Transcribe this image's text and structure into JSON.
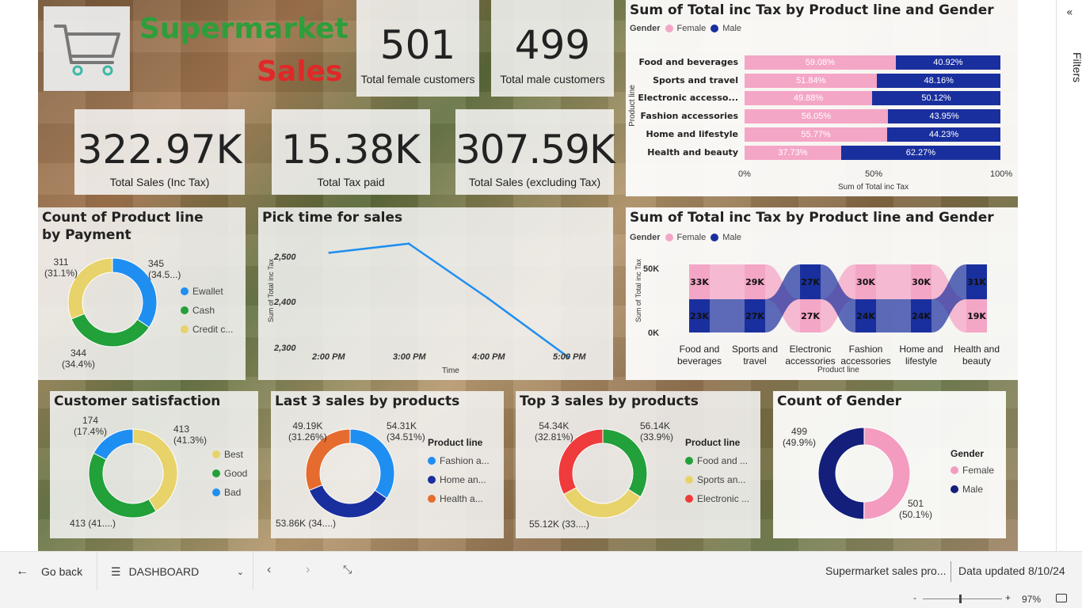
{
  "header": {
    "title_line1": "Supermarket",
    "title_line2": "Sales",
    "cart_icon": "shopping-cart-icon"
  },
  "kpis": {
    "female": {
      "value": "501",
      "label": "Total female customers"
    },
    "male": {
      "value": "499",
      "label": "Total male customers"
    },
    "sales_inc_tax": {
      "value": "322.97K",
      "label": "Total Sales (Inc Tax)"
    },
    "tax_paid": {
      "value": "15.38K",
      "label": "Total Tax  paid"
    },
    "sales_ex_tax": {
      "value": "307.59K",
      "label": "Total Sales (excluding Tax)"
    }
  },
  "colors": {
    "female": "#f4a6c6",
    "male": "#1a2f9e",
    "ewallet": "#1f8ef1",
    "cash": "#22a03a",
    "credit": "#e8d26a",
    "orange": "#e56c2e",
    "red": "#ef3b3b"
  },
  "stacked_bar": {
    "title": "Sum of Total inc Tax by Product line and Gender",
    "legend_title": "Gender",
    "female_label": "Female",
    "male_label": "Male",
    "ylabel": "Product line",
    "xlabel": "Sum of Total inc Tax",
    "ticks": [
      "0%",
      "50%",
      "100%"
    ],
    "rows": [
      {
        "label": "Food and beverages",
        "female": 59.08,
        "female_text": "59.08%",
        "male_text": "40.92%"
      },
      {
        "label": "Sports and travel",
        "female": 51.84,
        "female_text": "51.84%",
        "male_text": "48.16%"
      },
      {
        "label": "Electronic accesso...",
        "female": 49.88,
        "female_text": "49.88%",
        "male_text": "50.12%"
      },
      {
        "label": "Fashion accessories",
        "female": 56.05,
        "female_text": "56.05%",
        "male_text": "43.95%"
      },
      {
        "label": "Home and lifestyle",
        "female": 55.77,
        "female_text": "55.77%",
        "male_text": "44.23%"
      },
      {
        "label": "Health and beauty",
        "female": 37.73,
        "female_text": "37.73%",
        "male_text": "62.27%"
      }
    ]
  },
  "ribbon": {
    "title": "Sum of Total inc Tax by Product line and Gender",
    "legend_title": "Gender",
    "female_label": "Female",
    "male_label": "Male",
    "ylabel": "Sum of Total inc Tax",
    "xlabel": "Product line",
    "yticks": [
      "50K",
      "0K"
    ],
    "categories": [
      {
        "l1": "Food and",
        "l2": "beverages",
        "female": "33K",
        "male": "23K",
        "female_top": true
      },
      {
        "l1": "Sports and",
        "l2": "travel",
        "female": "29K",
        "male": "27K",
        "female_top": true
      },
      {
        "l1": "Electronic",
        "l2": "accessories",
        "female": "27K",
        "male": "27K",
        "female_top": false
      },
      {
        "l1": "Fashion",
        "l2": "accessories",
        "female": "30K",
        "male": "24K",
        "female_top": true
      },
      {
        "l1": "Home and",
        "l2": "lifestyle",
        "female": "30K",
        "male": "24K",
        "female_top": true
      },
      {
        "l1": "Health and",
        "l2": "beauty",
        "female": "19K",
        "male": "31K",
        "female_top": false
      }
    ]
  },
  "payment": {
    "title": "Count of Product line by Payment",
    "items": [
      {
        "label": "Ewallet",
        "value": 345,
        "annot1": "345",
        "annot2": "(34.5...)"
      },
      {
        "label": "Cash",
        "value": 344,
        "annot1": "344",
        "annot2": "(34.4%)"
      },
      {
        "label": "Credit c...",
        "value": 311,
        "annot1": "311",
        "annot2": "(31.1%)"
      }
    ]
  },
  "line_chart": {
    "title": "Pick time for sales",
    "ylabel": "Sum of Total inc Tax",
    "xlabel": "Time",
    "yticks": [
      "2,500",
      "2,400",
      "2,300"
    ],
    "xticks": [
      "2:00 PM",
      "3:00 PM",
      "4:00 PM",
      "5:00 PM"
    ]
  },
  "chart_data": {
    "type": "line",
    "title": "Pick time for sales",
    "xlabel": "Time",
    "ylabel": "Sum of Total inc Tax",
    "x": [
      "2:00 PM",
      "3:00 PM",
      "4:00 PM",
      "5:00 PM"
    ],
    "y": [
      2510,
      2530,
      2410,
      2280
    ],
    "ylim": [
      2280,
      2550
    ]
  },
  "satisfaction": {
    "title": "Customer satisfaction",
    "items": [
      {
        "label": "Best",
        "value": 413,
        "annot1": "413",
        "annot2": "(41.3%)"
      },
      {
        "label": "Good",
        "value": 413,
        "annot1": "413 (41....)",
        "annot2": ""
      },
      {
        "label": "Bad",
        "value": 174,
        "annot1": "174",
        "annot2": "(17.4%)"
      }
    ]
  },
  "last3": {
    "title": "Last 3 sales by products",
    "legend_title": "Product line",
    "items": [
      {
        "label": "Fashion a...",
        "value": 54.31,
        "annot1": "54.31K",
        "annot2": "(34.51%)"
      },
      {
        "label": "Home an...",
        "value": 53.86,
        "annot1": "53.86K (34....)",
        "annot2": ""
      },
      {
        "label": "Health a...",
        "value": 49.19,
        "annot1": "49.19K",
        "annot2": "(31.26%)"
      }
    ]
  },
  "top3": {
    "title": "Top 3 sales by products",
    "legend_title": "Product line",
    "items": [
      {
        "label": "Food and ...",
        "value": 56.14,
        "annot1": "56.14K",
        "annot2": "(33.9%)"
      },
      {
        "label": "Sports an...",
        "value": 55.12,
        "annot1": "55.12K (33....)",
        "annot2": ""
      },
      {
        "label": "Electronic ...",
        "value": 54.34,
        "annot1": "54.34K",
        "annot2": "(32.81%)"
      }
    ]
  },
  "gender_count": {
    "title": "Count of Gender",
    "legend_title": "Gender",
    "items": [
      {
        "label": "Female",
        "value": 501,
        "annot1": "501",
        "annot2": "(50.1%)"
      },
      {
        "label": "Male",
        "value": 499,
        "annot1": "499",
        "annot2": "(49.9%)"
      }
    ]
  },
  "footer": {
    "go_back": "Go back",
    "page": "DASHBOARD",
    "report_name": "Supermarket sales pro...",
    "updated": "Data updated 8/10/24"
  },
  "status": {
    "zoom": "97%",
    "minus": "-",
    "plus": "+"
  },
  "filters_label": "Filters"
}
